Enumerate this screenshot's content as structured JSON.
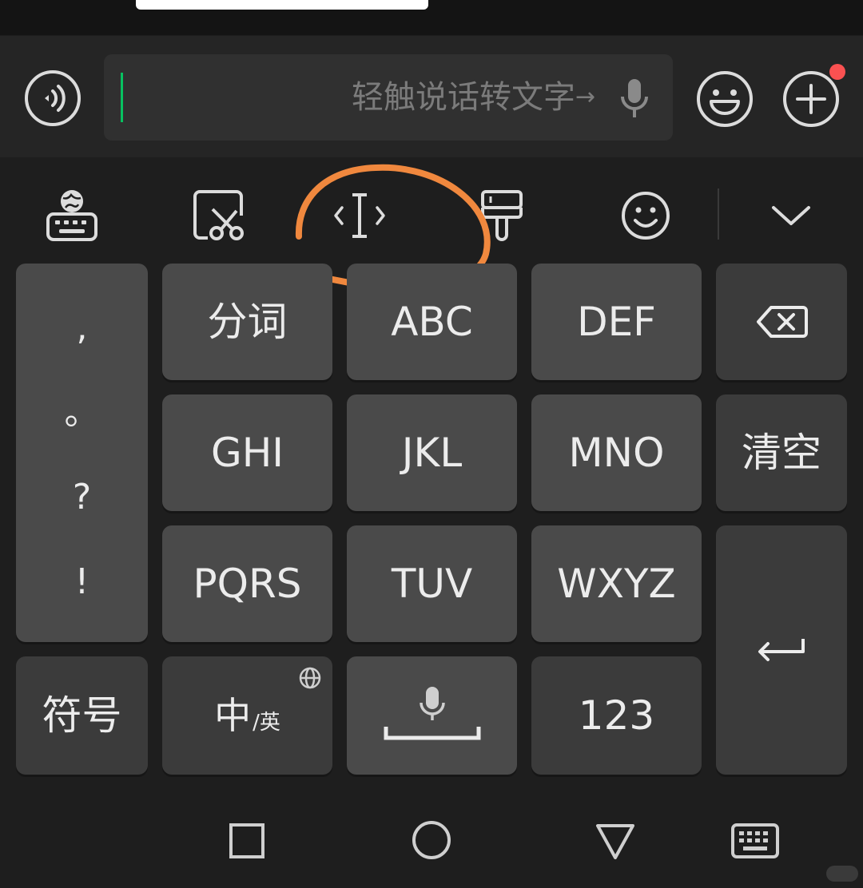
{
  "input_bar": {
    "hint": "轻触说话转文字",
    "hint_arrow": "→"
  },
  "toolbar": {
    "items": [
      "globe-keyboard-icon",
      "clipboard-cut-icon",
      "cursor-move-icon",
      "brush-icon",
      "emoji-icon",
      "collapse-icon"
    ]
  },
  "keyboard": {
    "punctuation": [
      ",",
      "。",
      "?",
      "!"
    ],
    "rows": [
      [
        "分词",
        "ABC",
        "DEF"
      ],
      [
        "GHI",
        "JKL",
        "MNO"
      ],
      [
        "PQRS",
        "TUV",
        "WXYZ"
      ]
    ],
    "clear_label": "清空",
    "symbols_label": "符号",
    "zh_label": "中",
    "en_label": "/英",
    "num_label": "123"
  },
  "colors": {
    "accent_green": "#07c160",
    "annotation_orange": "#f0883e",
    "badge_red": "#fa5151"
  }
}
